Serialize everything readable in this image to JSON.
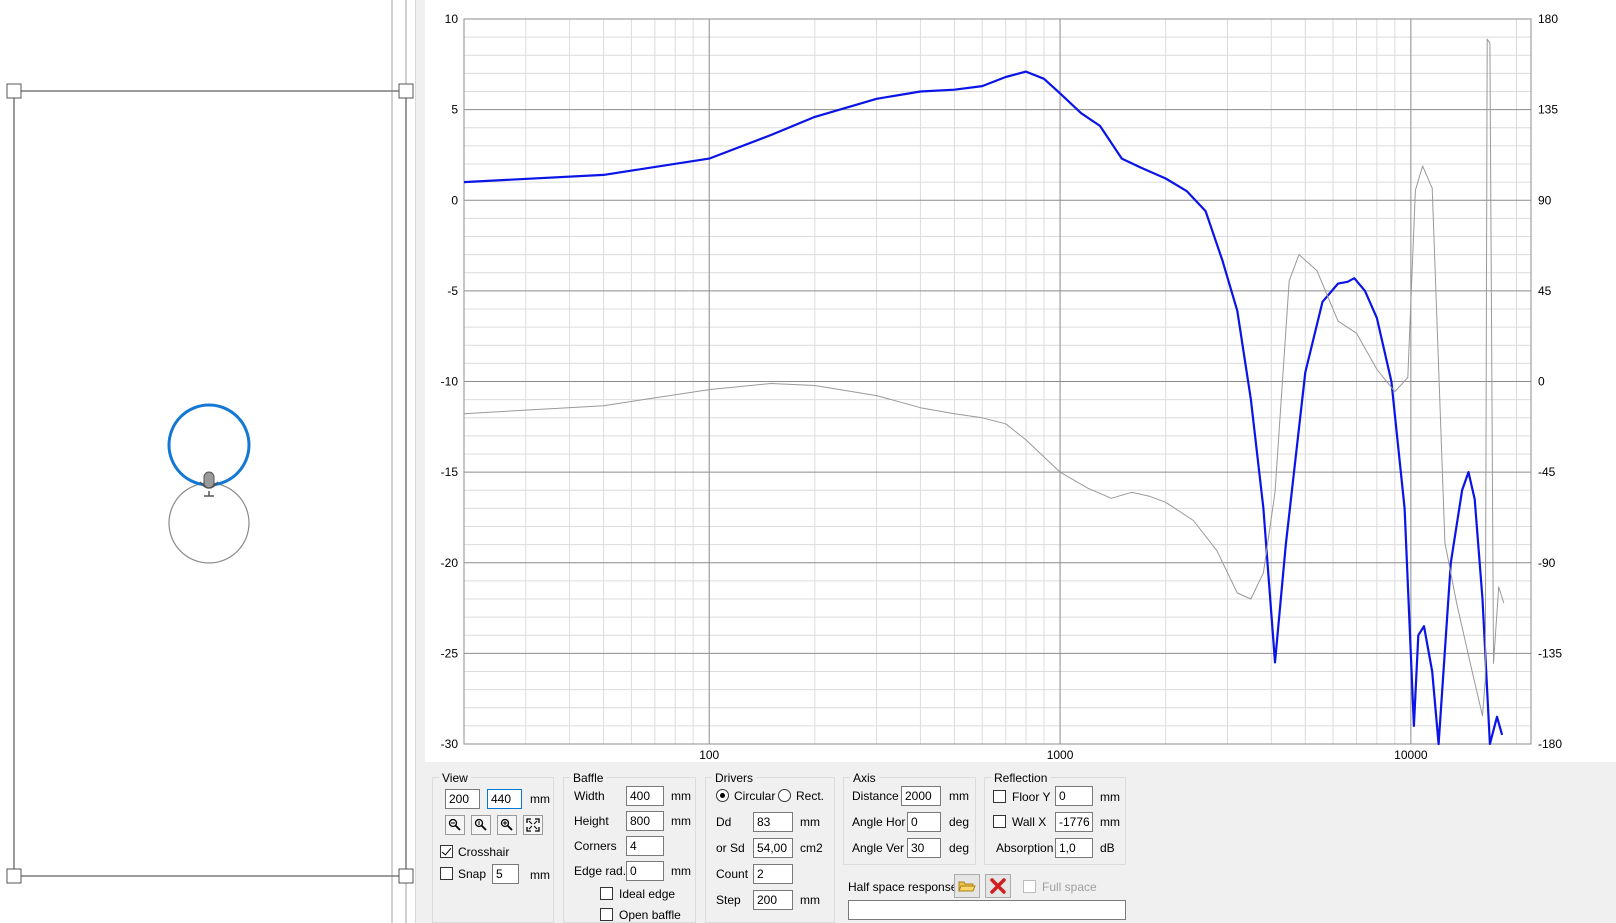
{
  "chart_data": {
    "type": "line",
    "x_scale": "log",
    "xlim": [
      20,
      22000
    ],
    "ylim": [
      -30,
      10
    ],
    "y2lim": [
      -180,
      180
    ],
    "x_tick_labels": [
      "100",
      "1000",
      "10000"
    ],
    "y_tick_labels": [
      "10",
      "5",
      "0",
      "-5",
      "-10",
      "-15",
      "-20",
      "-25",
      "-30"
    ],
    "y2_tick_labels": [
      "180",
      "135",
      "90",
      "45",
      "0",
      "-45",
      "-90",
      "-135",
      "-180"
    ],
    "grid": true,
    "series": [
      {
        "color": "#0a14e6",
        "axis": "left",
        "points": [
          [
            20,
            1.0
          ],
          [
            50,
            1.4
          ],
          [
            100,
            2.3
          ],
          [
            150,
            3.6
          ],
          [
            200,
            4.6
          ],
          [
            300,
            5.6
          ],
          [
            400,
            6.0
          ],
          [
            500,
            6.1
          ],
          [
            600,
            6.3
          ],
          [
            700,
            6.8
          ],
          [
            800,
            7.1
          ],
          [
            900,
            6.7
          ],
          [
            1000,
            5.9
          ],
          [
            1150,
            4.8
          ],
          [
            1300,
            4.1
          ],
          [
            1500,
            2.3
          ],
          [
            1700,
            1.8
          ],
          [
            2000,
            1.2
          ],
          [
            2300,
            0.5
          ],
          [
            2600,
            -0.6
          ],
          [
            2900,
            -3.3
          ],
          [
            3200,
            -6.1
          ],
          [
            3500,
            -11
          ],
          [
            3800,
            -17
          ],
          [
            4100,
            -25.5
          ],
          [
            4400,
            -19
          ],
          [
            5000,
            -9.5
          ],
          [
            5600,
            -5.6
          ],
          [
            6200,
            -4.6
          ],
          [
            6600,
            -4.5
          ],
          [
            6900,
            -4.3
          ],
          [
            7400,
            -5.0
          ],
          [
            8000,
            -6.5
          ],
          [
            8800,
            -10
          ],
          [
            9600,
            -17
          ],
          [
            10200,
            -29
          ],
          [
            10500,
            -24
          ],
          [
            10900,
            -23.5
          ],
          [
            11500,
            -26
          ],
          [
            12000,
            -30
          ],
          [
            13000,
            -20
          ],
          [
            14000,
            -16
          ],
          [
            14600,
            -15
          ],
          [
            15200,
            -16.5
          ],
          [
            16000,
            -22
          ],
          [
            16800,
            -30
          ],
          [
            17600,
            -28.5
          ],
          [
            18200,
            -29.5
          ]
        ]
      },
      {
        "color": "#999999",
        "axis": "right",
        "points": [
          [
            20,
            -16
          ],
          [
            50,
            -12
          ],
          [
            100,
            -4
          ],
          [
            150,
            -1
          ],
          [
            200,
            -2
          ],
          [
            300,
            -7
          ],
          [
            400,
            -13
          ],
          [
            500,
            -16
          ],
          [
            600,
            -18
          ],
          [
            700,
            -21
          ],
          [
            800,
            -29
          ],
          [
            1000,
            -45
          ],
          [
            1200,
            -53
          ],
          [
            1400,
            -58
          ],
          [
            1600,
            -55
          ],
          [
            1800,
            -57
          ],
          [
            2000,
            -60
          ],
          [
            2400,
            -69
          ],
          [
            2800,
            -84
          ],
          [
            3200,
            -105
          ],
          [
            3500,
            -108
          ],
          [
            3800,
            -95
          ],
          [
            4100,
            -55
          ],
          [
            4500,
            50
          ],
          [
            4800,
            63
          ],
          [
            5400,
            55
          ],
          [
            6200,
            30
          ],
          [
            7000,
            24
          ],
          [
            8000,
            6
          ],
          [
            9000,
            -5
          ],
          [
            9800,
            2
          ],
          [
            10300,
            95
          ],
          [
            10800,
            107
          ],
          [
            11500,
            96
          ],
          [
            12500,
            -80
          ],
          [
            13500,
            -110
          ],
          [
            15000,
            -145
          ],
          [
            16000,
            -166
          ],
          [
            16300,
            -148
          ],
          [
            16500,
            170
          ],
          [
            16800,
            168
          ],
          [
            17200,
            -140
          ],
          [
            17800,
            -102
          ],
          [
            18400,
            -110
          ]
        ]
      }
    ]
  },
  "view": {
    "title": "View",
    "x_value": "200",
    "y_value": "440",
    "unit": "mm",
    "crosshair_label": "Crosshair",
    "crosshair_checked": true,
    "snap_label": "Snap",
    "snap_value": "5",
    "snap_unit": "mm",
    "icons": [
      "zoom-out-icon",
      "zoom-reset-icon",
      "zoom-in-icon",
      "fit-view-icon"
    ]
  },
  "baffle": {
    "title": "Baffle",
    "width_label": "Width",
    "width_value": "400",
    "height_label": "Height",
    "height_value": "800",
    "corners_label": "Corners",
    "corners_value": "4",
    "edge_label": "Edge rad.",
    "edge_value": "0",
    "unit": "mm",
    "ideal_edge_label": "Ideal edge",
    "open_baffle_label": "Open baffle"
  },
  "drivers": {
    "title": "Drivers",
    "circular_label": "Circular",
    "rect_label": "Rect.",
    "shape_selected": "Circular",
    "dd_label": "Dd",
    "dd_value": "83",
    "dd_unit": "mm",
    "sd_label": "or Sd",
    "sd_value": "54,00",
    "sd_unit": "cm2",
    "count_label": "Count",
    "count_value": "2",
    "step_label": "Step",
    "step_value": "200",
    "step_unit": "mm"
  },
  "axis": {
    "title": "Axis",
    "distance_label": "Distance",
    "distance_value": "2000",
    "distance_unit": "mm",
    "hor_label": "Angle Hor",
    "hor_value": "0",
    "ver_label": "Angle Ver",
    "ver_value": "30",
    "deg_unit": "deg"
  },
  "reflection": {
    "title": "Reflection",
    "floor_label": "Floor Y",
    "floor_value": "0",
    "wall_label": "Wall  X",
    "wall_value": "-1776",
    "mm_unit": "mm",
    "absorption_label": "Absorption",
    "absorption_value": "1,0",
    "db_unit": "dB"
  },
  "half_space": {
    "label": "Half space response",
    "full_space_label": "Full space",
    "path_value": ""
  }
}
